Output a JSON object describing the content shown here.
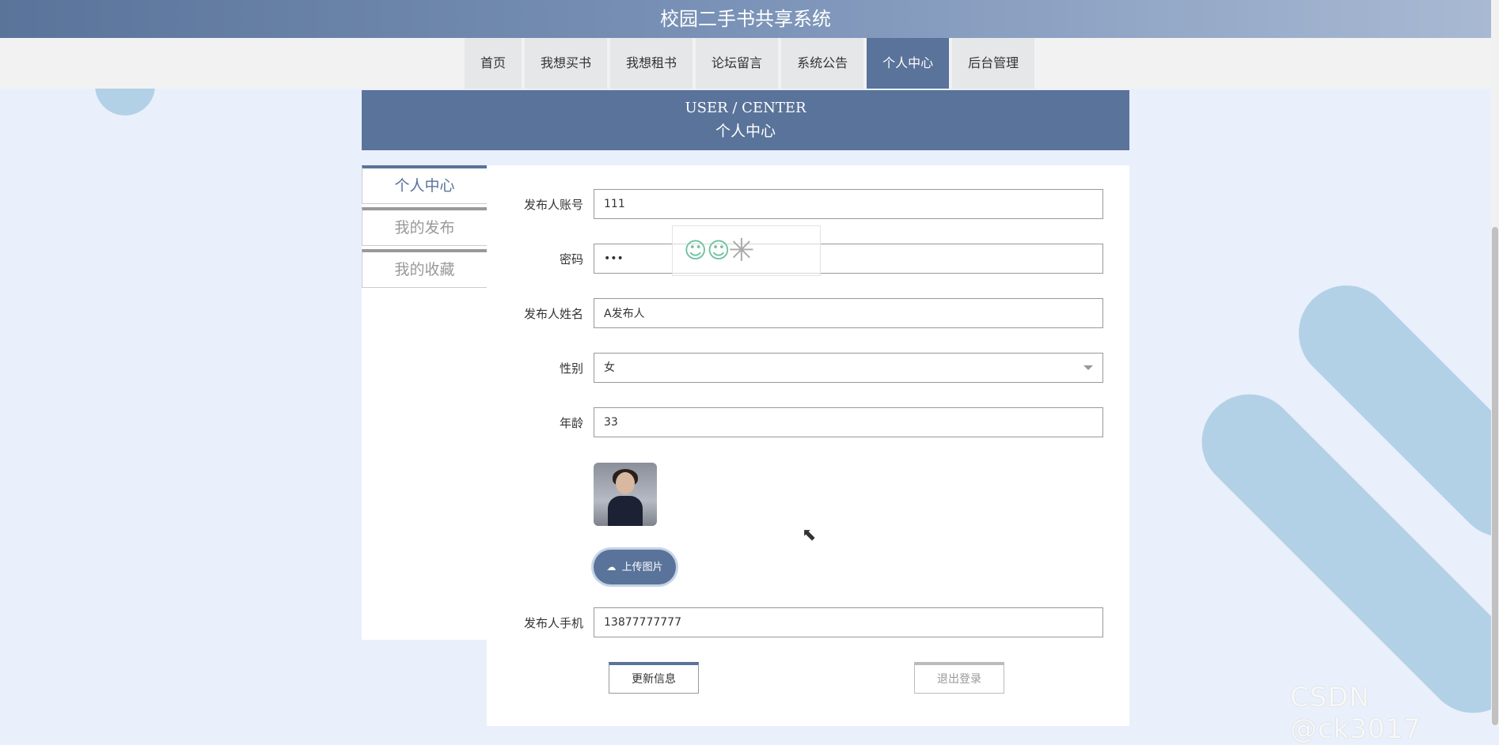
{
  "app": {
    "title": "校园二手书共享系统"
  },
  "nav": [
    {
      "label": "首页",
      "active": false
    },
    {
      "label": "我想买书",
      "active": false
    },
    {
      "label": "我想租书",
      "active": false
    },
    {
      "label": "论坛留言",
      "active": false
    },
    {
      "label": "系统公告",
      "active": false
    },
    {
      "label": "个人中心",
      "active": true
    },
    {
      "label": "后台管理",
      "active": false
    }
  ],
  "page_header": {
    "en": "USER / CENTER",
    "cn": "个人中心"
  },
  "side_menu": [
    {
      "label": "个人中心",
      "active": true
    },
    {
      "label": "我的发布",
      "active": false
    },
    {
      "label": "我的收藏",
      "active": false
    }
  ],
  "form": {
    "account": {
      "label": "发布人账号",
      "value": "111"
    },
    "password": {
      "label": "密码",
      "value": "•••"
    },
    "name": {
      "label": "发布人姓名",
      "value": "A发布人"
    },
    "gender": {
      "label": "性别",
      "value": "女"
    },
    "age": {
      "label": "年龄",
      "value": "33"
    },
    "phone": {
      "label": "发布人手机",
      "value": "13877777777"
    },
    "upload_label": "上传图片",
    "update_label": "更新信息",
    "logout_label": "退出登录"
  },
  "watermark": "CSDN @ck3017",
  "colors": {
    "accent": "#5a739a",
    "background": "#e9f0fb",
    "decor": "#b3d1e6"
  },
  "icons": {
    "upload": "cloud-upload-icon",
    "select": "chevron-down-icon",
    "cursor": "mouse-pointer-icon"
  }
}
